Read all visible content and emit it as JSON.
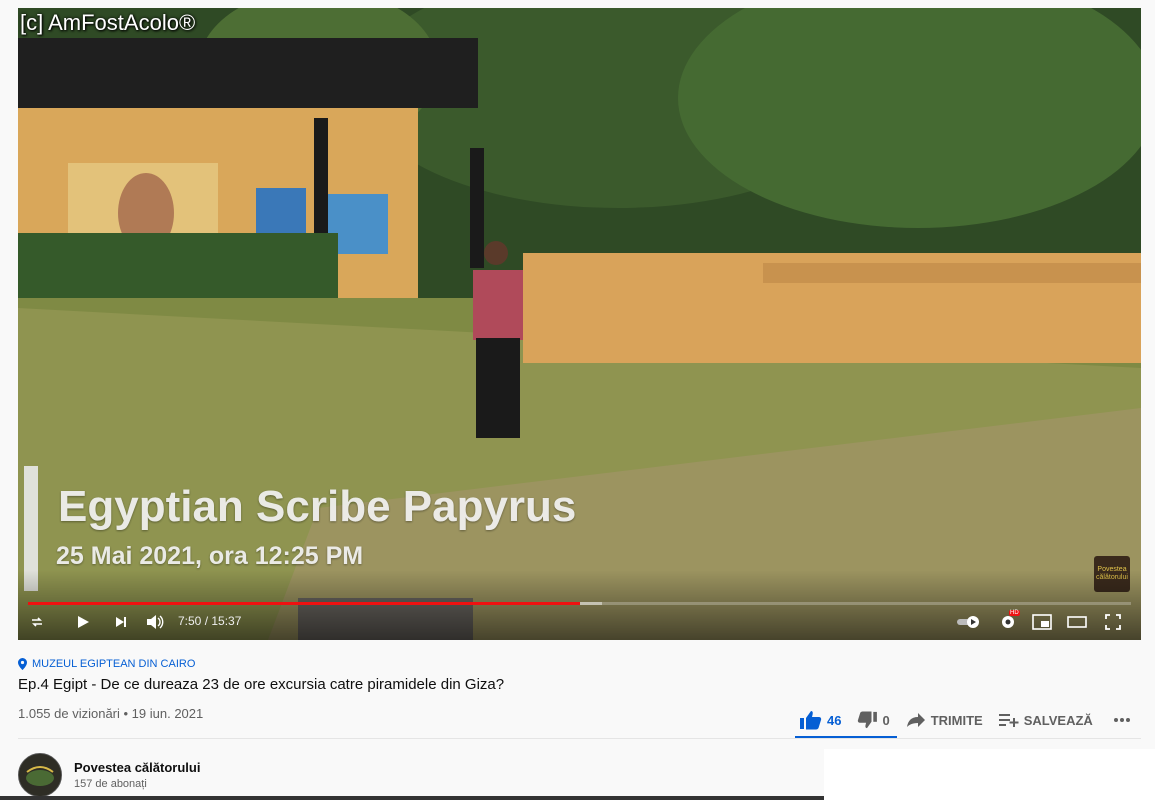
{
  "video": {
    "watermark": "[c] AmFostAcolo®",
    "overlay_title": "Egyptian Scribe Papyrus",
    "overlay_date": "25 Mai 2021, ora 12:25 PM",
    "channel_watermark": "Povestea călătorului",
    "time_display": "7:50 / 15:37",
    "progress_played": 0.5,
    "progress_buffered": 0.52,
    "hd_badge": "HD"
  },
  "info": {
    "location_tag": "MUZEUL EGIPTEAN DIN CAIRO",
    "title": "Ep.4 Egipt - De ce dureaza 23 de ore excursia catre piramidele din Giza?",
    "meta": "1.055 de vizionări • 19 iun. 2021"
  },
  "actions": {
    "likes": "46",
    "dislikes": "0",
    "share_label": "TRIMITE",
    "save_label": "SALVEAZĂ"
  },
  "channel": {
    "name": "Povestea călătorului",
    "subscribers": "157 de abonați"
  },
  "colors": {
    "accent": "#065fd4",
    "progress": "#ee1111"
  }
}
